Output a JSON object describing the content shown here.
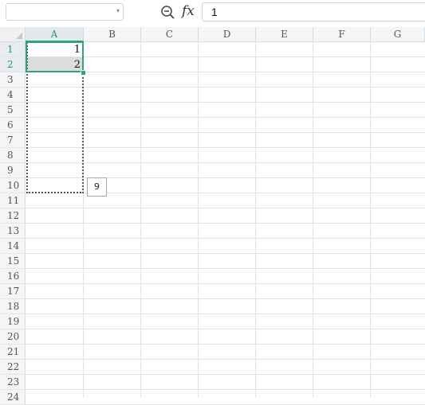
{
  "formula_bar": {
    "name_box": "",
    "fx_label": "fx",
    "formula_value": "1"
  },
  "columns": [
    "A",
    "B",
    "C",
    "D",
    "E",
    "F",
    "G"
  ],
  "rows": [
    "1",
    "2",
    "3",
    "4",
    "5",
    "6",
    "7",
    "8",
    "9",
    "10",
    "11",
    "12",
    "13",
    "14",
    "15",
    "16",
    "17",
    "18",
    "19",
    "20",
    "21",
    "22",
    "23",
    "24"
  ],
  "active_column": "A",
  "active_rows": [
    "1",
    "2"
  ],
  "cells": {
    "A1": "1",
    "A2": "2"
  },
  "fill_tooltip": "9",
  "colors": {
    "selection": "#2ca57a",
    "active_header_text": "#1e9a6e"
  }
}
